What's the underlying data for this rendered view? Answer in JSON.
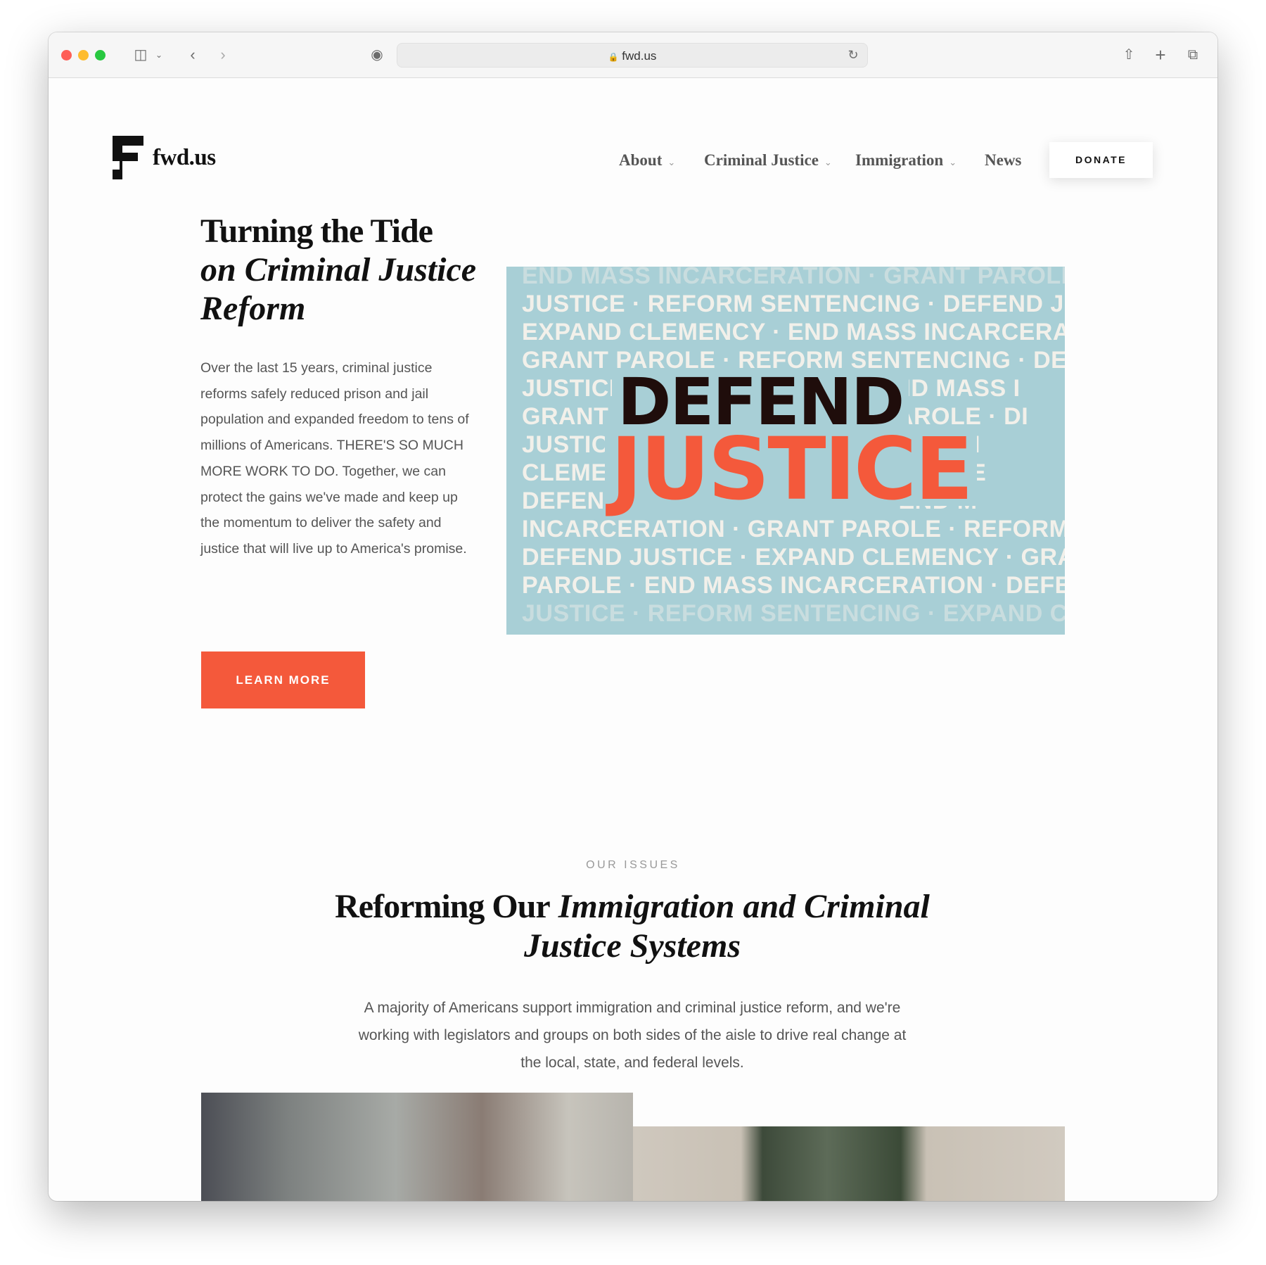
{
  "browser": {
    "url": "fwd.us",
    "icons": [
      "sidebar-icon",
      "chevron-down-icon",
      "back-icon",
      "forward-icon",
      "privacy-report-icon",
      "lock-icon",
      "reload-icon",
      "share-icon",
      "new-tab-icon",
      "tab-overview-icon"
    ]
  },
  "header": {
    "logo_text": "fwd.us",
    "nav": [
      {
        "label": "About",
        "has_dropdown": true
      },
      {
        "label": "Criminal Justice",
        "has_dropdown": true
      },
      {
        "label": "Immigration",
        "has_dropdown": true
      },
      {
        "label": "News",
        "has_dropdown": false
      }
    ],
    "donate_label": "DONATE"
  },
  "hero": {
    "title_bold": "Turning the Tide",
    "title_italic": "on Criminal Justice Reform",
    "body": "Over the last 15 years, criminal justice reforms safely reduced prison and jail population and expanded freedom to tens of millions of Americans. THERE'S SO MUCH MORE WORK TO DO. Together, we can protect the gains we've made and keep up the momentum to deliver the safety and justice that will live up to America's promise.",
    "cta_label": "LEARN MORE",
    "cta_color": "#f4593b",
    "image": {
      "background_color": "#a8cfd6",
      "headline_top": "DEFEND",
      "headline_bottom": "JUSTICE",
      "headline_top_color": "#1f0d0b",
      "headline_bottom_color": "#f4593b",
      "rows": [
        "END MASS INCARCERATION · GRANT PAROLE",
        "JUSTICE · REFORM SENTENCING · DEFEND JU",
        "EXPAND CLEMENCY · END MASS INCARCERAT",
        "GRANT PAROLE · REFORM SENTENCING · DEF",
        "JUSTICE                                    END MASS I",
        "GRANT                                       PAROLE · DI",
        "JUSTICE                                       EXPAN",
        "CLEMEN                                        SENTE",
        "DEFEN                                          END M",
        "INCARCERATION · GRANT PAROLE · REFORM",
        "DEFEND JUSTICE · EXPAND CLEMENCY · GRA",
        "PAROLE · END MASS INCARCERATION · DEFE",
        "JUSTICE · REFORM SENTENCING · EXPAND C"
      ]
    }
  },
  "issues": {
    "eyebrow": "OUR ISSUES",
    "heading_bold": "Reforming Our",
    "heading_italic": "Immigration and Criminal Justice Systems",
    "body": "A majority of Americans support immigration and criminal justice reform, and we're working with legislators and groups on both sides of the aisle to drive real change at the local, state, and federal levels."
  }
}
